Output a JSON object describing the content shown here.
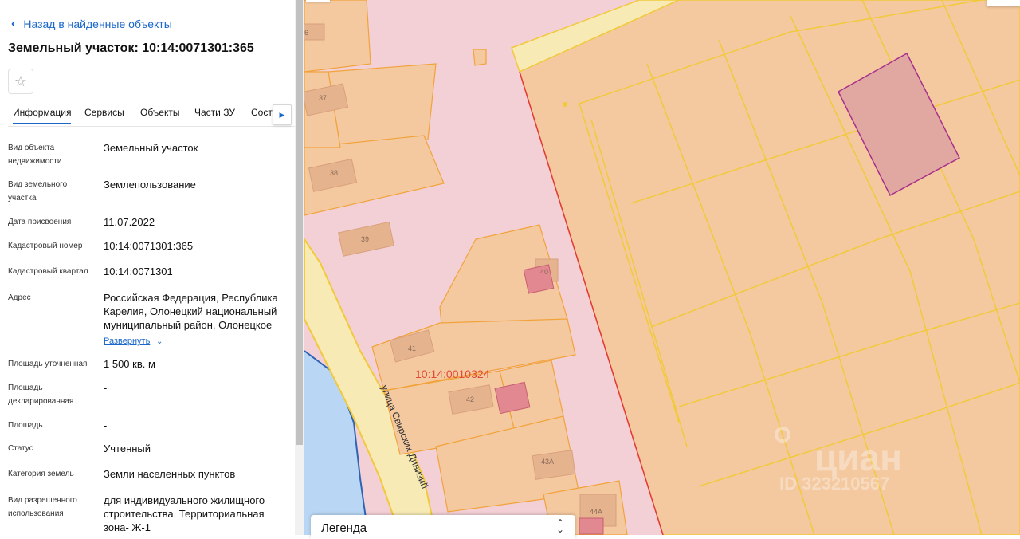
{
  "panel": {
    "back_label": "Назад в найденные объекты",
    "title": "Земельный участок: 10:14:0071301:365",
    "tabs": [
      "Информация",
      "Сервисы",
      "Объекты",
      "Части ЗУ",
      "Соста..."
    ],
    "properties": [
      {
        "label": "Вид объекта недвижимости",
        "value": "Земельный участок"
      },
      {
        "label": "Вид земельного участка",
        "value": "Землепользование"
      },
      {
        "label": "Дата присвоения",
        "value": "11.07.2022"
      },
      {
        "label": "Кадастровый номер",
        "value": "10:14:0071301:365"
      },
      {
        "label": "Кадастровый квартал",
        "value": "10:14:0071301"
      },
      {
        "label": "Адрес",
        "value": "Российская Федерация, Республика Карелия, Олонецкий национальный муниципальный район, Олонецкое"
      },
      {
        "label": "Площадь уточненная",
        "value": "1 500 кв. м"
      },
      {
        "label": "Площадь декларированная",
        "value": "-"
      },
      {
        "label": "Площадь",
        "value": "-"
      },
      {
        "label": "Статус",
        "value": "Учтенный"
      },
      {
        "label": "Категория земель",
        "value": "Земли населенных пунктов"
      },
      {
        "label": "Вид разрешенного использования",
        "value": "для индивидуального жилищного строительства. Территориальная зона- Ж-1"
      }
    ],
    "expand_label": "Развернуть"
  },
  "map": {
    "plot_numbers": [
      "6",
      "37",
      "38",
      "39",
      "40",
      "41",
      "42",
      "43А",
      "44А"
    ],
    "quarter_label": "10:14:0010324",
    "street_label": "улица Свирских Дивизий",
    "watermark_brand": "циан",
    "watermark_id": "ID 323210567",
    "legend_title": "Легенда",
    "legend_arrows": "⌃⌄"
  },
  "colors": {
    "accent": "#1a66c9",
    "parcel_fill": "#f4c9a0",
    "parcel_stroke": "#f1c93a",
    "quarter_fill": "#f3cfd6",
    "selected_fill": "#e0a8a0",
    "selected_stroke": "#a8308c",
    "water": "#b9d7f4",
    "road": "#f7eab4",
    "building": "#e28890"
  }
}
